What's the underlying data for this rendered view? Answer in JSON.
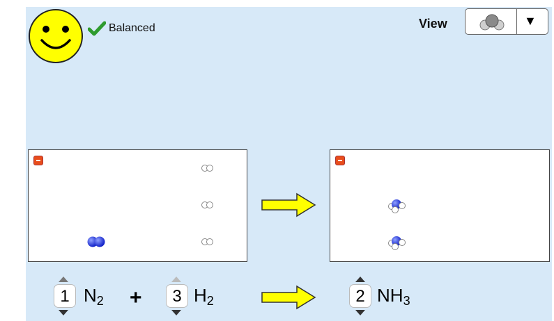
{
  "status": {
    "label": "Balanced",
    "face": "smiley-icon",
    "check": "checkmark-icon"
  },
  "view": {
    "label": "View",
    "selected_icon": "molecule-icon",
    "dropdown": "triangle-down-icon"
  },
  "colors": {
    "background": "#d7e9f8",
    "nitrogen": "#2233dd",
    "hydrogen": "#ffffff",
    "arrow": "#ffff00",
    "minus_button": "#e84d1c",
    "smiley": "#ffff00",
    "check": "#2e9b2e"
  },
  "equation": {
    "reactants": [
      {
        "coefficient": "1",
        "symbol": "N",
        "subscript": "2"
      },
      {
        "coefficient": "3",
        "symbol": "H",
        "subscript": "2"
      }
    ],
    "plus": "+",
    "products": [
      {
        "coefficient": "2",
        "symbol": "NH",
        "subscript": "3"
      }
    ]
  },
  "reactant_box": {
    "molecules": [
      "N2",
      "H2",
      "H2",
      "H2"
    ]
  },
  "product_box": {
    "molecules": [
      "NH3",
      "NH3"
    ]
  }
}
